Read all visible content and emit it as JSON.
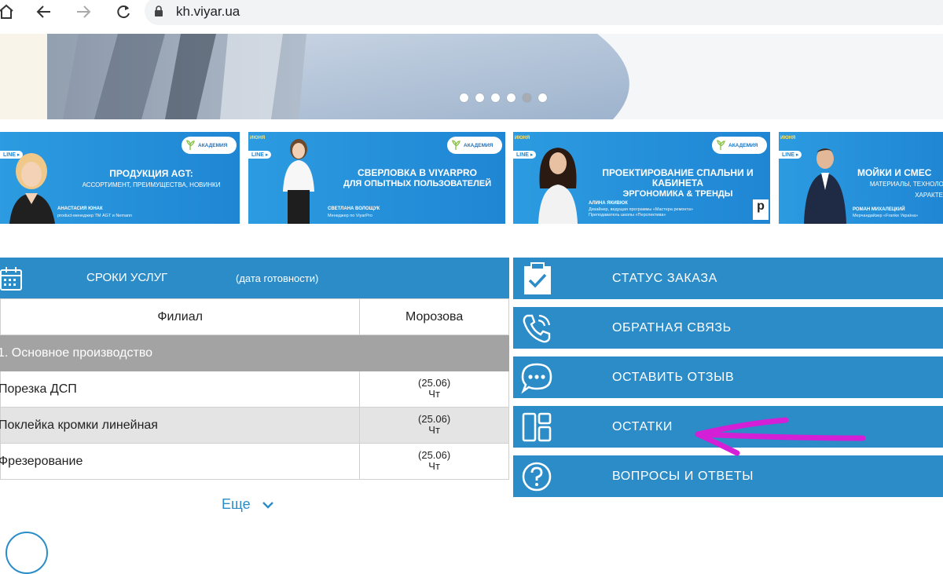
{
  "browser": {
    "url": "kh.viyar.ua"
  },
  "slider": {
    "dot_count": 6,
    "active_index": 4
  },
  "banners": [
    {
      "month": "ИЮНЯ",
      "title": "ПРОДУКЦИЯ AGT:",
      "subtitle": "АССОРТИМЕНТ, ПРЕИМУЩЕСТВА, НОВИНКИ",
      "person": "АНАСТАСИЯ ЮНАК",
      "role": "product-менеджер ТМ AGT и Nemann",
      "brand": "АКАДЕМИЯ"
    },
    {
      "month": "ИЮНЯ",
      "title": "СВЕРЛОВКА В VIYARPRO",
      "subtitle": "ДЛЯ ОПЫТНЫХ ПОЛЬЗОВАТЕЛЕЙ",
      "person": "СВЕТЛАНА ВОЛОЩУК",
      "role": "Менеджер по ViyarPro",
      "brand": "АКАДЕМИЯ"
    },
    {
      "month": "ИЮНЯ",
      "title": "ПРОЕКТИРОВАНИЕ СПАЛЬНИ И КАБИНЕТА",
      "subtitle": "ЭРГОНОМИКА & ТРЕНДЫ",
      "person": "АЛИНА ЯКИВЮК",
      "role": "Дизайнер, ведущая программы «Мастера ремонта»",
      "role2": "Преподаватель школы «Перспектива»",
      "brand": "АКАДЕМИЯ"
    },
    {
      "month": "ИЮНЯ",
      "title": "МОЙКИ И СМЕС",
      "subtitle": "МАТЕРИАЛЫ, ТЕХНОЛОГ",
      "subtitle2": "ХАРАКТЕРИ",
      "person": "РОМАН МИХАЛЕЦКИЙ",
      "role": "Мерчандайзер «Franke Україна»",
      "brand": "АКАДЕМИЯ"
    }
  ],
  "services": {
    "title": "СРОКИ УСЛУГ",
    "subtitle": "(дата готовности)",
    "col_branch": "Филиал",
    "col_location": "Морозова",
    "section": "1. Основное производство",
    "rows": [
      {
        "name": "Порезка ДСП",
        "date": "(25.06)",
        "day": "Чт"
      },
      {
        "name": "Поклейка кромки линейная",
        "date": "(25.06)",
        "day": "Чт"
      },
      {
        "name": "Фрезерование",
        "date": "(25.06)",
        "day": "Чт"
      }
    ],
    "more": "Еще"
  },
  "menu": [
    {
      "label": "СТАТУС ЗАКАЗА",
      "icon": "clipboard-check-icon"
    },
    {
      "label": "ОБРАТНАЯ СВЯЗЬ",
      "icon": "phone-call-icon"
    },
    {
      "label": "ОСТАВИТЬ ОТЗЫВ",
      "icon": "chat-bubble-icon"
    },
    {
      "label": "ОСТАТКИ",
      "icon": "layout-panels-icon"
    },
    {
      "label": "ВОПРОСЫ И ОТВЕТЫ",
      "icon": "question-circle-icon"
    }
  ],
  "colors": {
    "primary": "#2b8cc8",
    "section_bg": "#a3a3a3",
    "alt_row": "#e4e4e4",
    "annotation_arrow": "#d31fd6"
  }
}
